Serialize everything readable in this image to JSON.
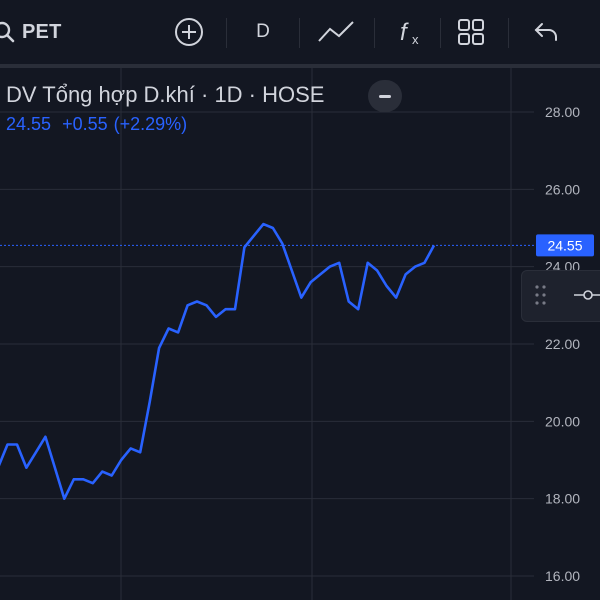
{
  "toolbar": {
    "symbol": "PET",
    "interval": "D",
    "icons": [
      "search-icon",
      "add-compare-icon",
      "indicator-line-icon",
      "fx-icon",
      "layout-grid-icon",
      "undo-icon"
    ]
  },
  "legend": {
    "title": "DV Tổng hợp D.khí · 1D · HOSE",
    "last_price": "24.55",
    "change": "+0.55",
    "change_percent": "(+2.29%)"
  },
  "colors": {
    "background": "#131722",
    "line": "#2962ff",
    "grid": "#2a2e39",
    "axis_text": "#b2b5be",
    "price_label_bg": "#2962ff"
  },
  "chart_data": {
    "type": "line",
    "title": "DV Tổng hợp D.khí · 1D · HOSE",
    "xlabel": "",
    "ylabel": "",
    "ylim": [
      16.0,
      29.0
    ],
    "y_ticks": [
      "16.00",
      "18.00",
      "20.00",
      "22.00",
      "24.00",
      "26.00",
      "28.00"
    ],
    "last_value_label": "24.55",
    "grid": true,
    "series": [
      {
        "values": [
          18.8,
          19.4,
          19.4,
          18.8,
          19.2,
          19.6,
          18.8,
          18.0,
          18.5,
          18.5,
          18.4,
          18.7,
          18.6,
          19.0,
          19.3,
          19.2,
          20.5,
          21.9,
          22.4,
          22.3,
          23.0,
          23.1,
          23.0,
          22.7,
          22.9,
          22.9,
          24.5,
          24.8,
          25.1,
          25.0,
          24.6,
          23.9,
          23.2,
          23.6,
          23.8,
          24.0,
          24.1,
          23.1,
          22.9,
          24.1,
          23.9,
          23.5,
          23.2,
          23.8,
          24.0,
          24.1,
          24.55
        ]
      }
    ]
  }
}
